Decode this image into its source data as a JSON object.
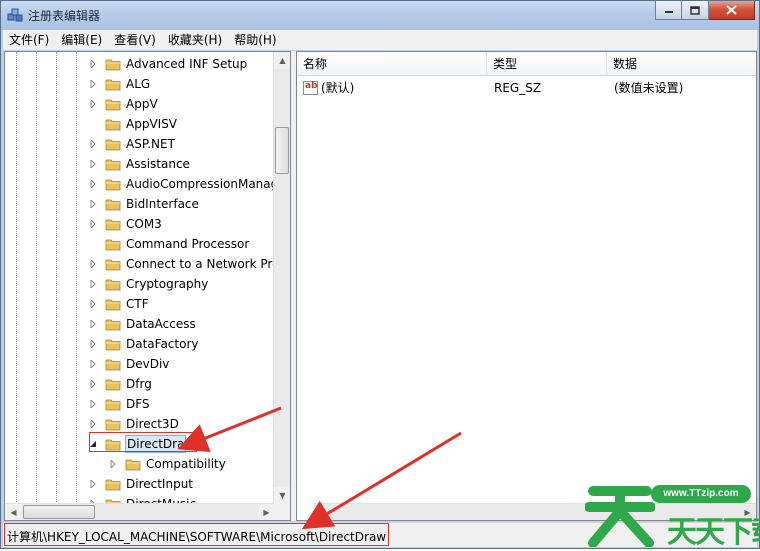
{
  "window": {
    "title": "注册表编辑器"
  },
  "menu": [
    "文件(F)",
    "编辑(E)",
    "查看(V)",
    "收藏夹(H)",
    "帮助(H)"
  ],
  "tree": {
    "items": [
      {
        "label": "Advanced INF Setup",
        "expander": "collapsed",
        "depth": 0
      },
      {
        "label": "ALG",
        "expander": "collapsed",
        "depth": 0
      },
      {
        "label": "AppV",
        "expander": "collapsed",
        "depth": 0
      },
      {
        "label": "AppVISV",
        "expander": "none",
        "depth": 0
      },
      {
        "label": "ASP.NET",
        "expander": "collapsed",
        "depth": 0
      },
      {
        "label": "Assistance",
        "expander": "collapsed",
        "depth": 0
      },
      {
        "label": "AudioCompressionManag",
        "expander": "collapsed",
        "depth": 0
      },
      {
        "label": "BidInterface",
        "expander": "collapsed",
        "depth": 0
      },
      {
        "label": "COM3",
        "expander": "collapsed",
        "depth": 0
      },
      {
        "label": "Command Processor",
        "expander": "none",
        "depth": 0
      },
      {
        "label": "Connect to a Network Pro",
        "expander": "collapsed",
        "depth": 0
      },
      {
        "label": "Cryptography",
        "expander": "collapsed",
        "depth": 0
      },
      {
        "label": "CTF",
        "expander": "collapsed",
        "depth": 0
      },
      {
        "label": "DataAccess",
        "expander": "collapsed",
        "depth": 0
      },
      {
        "label": "DataFactory",
        "expander": "collapsed",
        "depth": 0
      },
      {
        "label": "DevDiv",
        "expander": "collapsed",
        "depth": 0
      },
      {
        "label": "Dfrg",
        "expander": "collapsed",
        "depth": 0
      },
      {
        "label": "DFS",
        "expander": "collapsed",
        "depth": 0
      },
      {
        "label": "Direct3D",
        "expander": "collapsed",
        "depth": 0
      },
      {
        "label": "DirectDra",
        "expander": "expanded",
        "depth": 0,
        "selected": true
      },
      {
        "label": "Compatibility",
        "expander": "collapsed",
        "depth": 1
      },
      {
        "label": "DirectInput",
        "expander": "collapsed",
        "depth": 0
      },
      {
        "label": "DirectMusic",
        "expander": "collapsed",
        "depth": 0
      }
    ]
  },
  "list": {
    "columns": [
      "名称",
      "类型",
      "数据"
    ],
    "rows": [
      {
        "name": "(默认)",
        "type": "REG_SZ",
        "data": "(数值未设置)"
      }
    ]
  },
  "status": {
    "path": "计算机\\HKEY_LOCAL_MACHINE\\SOFTWARE\\Microsoft\\DirectDraw"
  },
  "watermark": {
    "url": "www.TTzip.com",
    "text": "天天下载"
  },
  "colors": {
    "annotation": "#e0302a",
    "watermark": "#2ea84a",
    "folder": "#e8c25a"
  },
  "icons": {
    "app": "registry-editor-icon",
    "folder": "folder-icon",
    "value": "string-value-icon"
  }
}
